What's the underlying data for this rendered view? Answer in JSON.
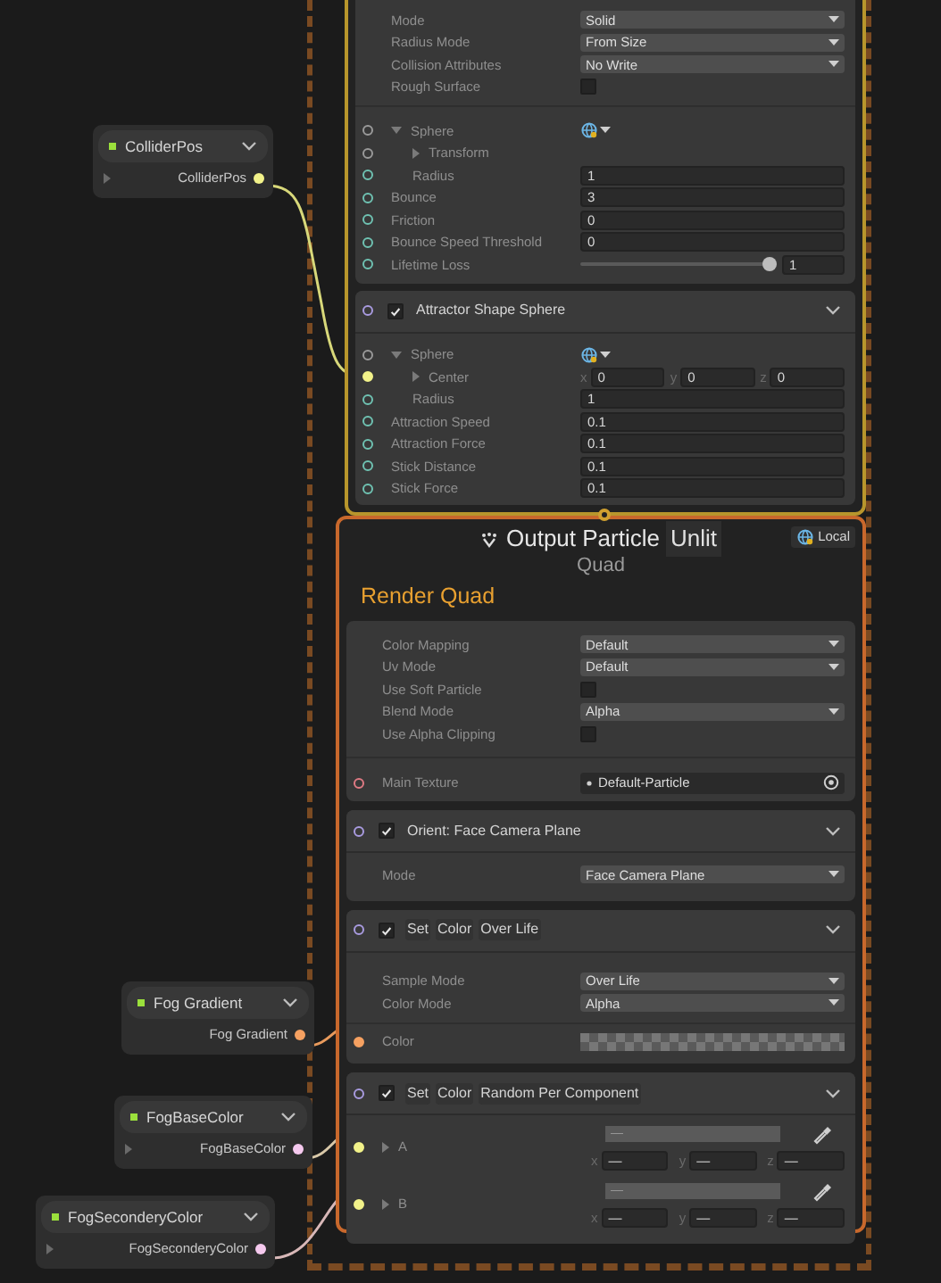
{
  "parameter_nodes": [
    {
      "title": "ColliderPos",
      "port_label": "ColliderPos",
      "expandable": true,
      "color": "#f2f28a"
    },
    {
      "title": "Fog Gradient",
      "port_label": "Fog Gradient",
      "expandable": false,
      "color": "#f6a161"
    },
    {
      "title": "FogBaseColor",
      "port_label": "FogBaseColor",
      "expandable": true,
      "color": "#f5c9ee"
    },
    {
      "title": "FogSeconderyColor",
      "port_label": "FogSeconderyColor",
      "expandable": true,
      "color": "#f5c9ee"
    }
  ],
  "collision_context": {
    "blocks": [
      {
        "sections": [
          [
            {
              "kind": "dropdown",
              "label": "Mode",
              "value": "Solid"
            },
            {
              "kind": "dropdown",
              "label": "Radius Mode",
              "value": "From Size"
            },
            {
              "kind": "dropdown",
              "label": "Collision Attributes",
              "value": "No Write"
            },
            {
              "kind": "checkbox",
              "label": "Rough Surface",
              "checked": false
            }
          ],
          [
            {
              "kind": "group",
              "label": "Sphere",
              "expanded": true,
              "port": {
                "color": "#9a9a9a",
                "connected": false
              },
              "children": [
                {
                  "kind": "foldout",
                  "label": "Transform",
                  "expanded": false,
                  "port": {
                    "color": "#9a9a9a",
                    "connected": false
                  }
                },
                {
                  "kind": "field",
                  "label": "Radius",
                  "value": "1",
                  "port": {
                    "color": "#6fc2b2",
                    "connected": false
                  }
                }
              ]
            },
            {
              "kind": "field",
              "label": "Bounce",
              "value": "3",
              "port": {
                "color": "#6fc2b2",
                "connected": false
              }
            },
            {
              "kind": "field",
              "label": "Friction",
              "value": "0",
              "port": {
                "color": "#6fc2b2",
                "connected": false
              }
            },
            {
              "kind": "field",
              "label": "Bounce Speed Threshold",
              "value": "0",
              "port": {
                "color": "#6fc2b2",
                "connected": false
              }
            },
            {
              "kind": "slider",
              "label": "Lifetime Loss",
              "level": 0.96,
              "value": "1",
              "port": {
                "color": "#6fc2b2",
                "connected": false
              }
            }
          ]
        ]
      },
      {
        "header": {
          "checked": true,
          "title_parts": [
            "Attractor Shape Sphere"
          ],
          "port": {
            "color": "#a99be0",
            "connected": false
          }
        },
        "sections": [
          [
            {
              "kind": "group",
              "label": "Sphere",
              "expanded": true,
              "port": {
                "color": "#9a9a9a",
                "connected": false
              },
              "children": [
                {
                  "kind": "vector",
                  "label": "Center",
                  "expanded": false,
                  "port": {
                    "color": "#f2f28a",
                    "connected": true
                  },
                  "components": [
                    {
                      "axis": "x",
                      "value": "0"
                    },
                    {
                      "axis": "y",
                      "value": "0"
                    },
                    {
                      "axis": "z",
                      "value": "0"
                    }
                  ]
                },
                {
                  "kind": "field",
                  "label": "Radius",
                  "value": "1",
                  "port": {
                    "color": "#6fc2b2",
                    "connected": false
                  }
                }
              ]
            },
            {
              "kind": "field",
              "label": "Attraction Speed",
              "value": "0.1",
              "port": {
                "color": "#6fc2b2",
                "connected": false
              }
            },
            {
              "kind": "field",
              "label": "Attraction Force",
              "value": "0.1",
              "port": {
                "color": "#6fc2b2",
                "connected": false
              }
            },
            {
              "kind": "field",
              "label": "Stick Distance",
              "value": "0.1",
              "port": {
                "color": "#6fc2b2",
                "connected": false
              }
            },
            {
              "kind": "field",
              "label": "Stick Force",
              "value": "0.1",
              "port": {
                "color": "#6fc2b2",
                "connected": false
              }
            }
          ]
        ]
      }
    ]
  },
  "output_context": {
    "title": "Output Particle",
    "title_tag": "Unlit",
    "space": "Local",
    "subtitle": "Quad",
    "label": "Render Quad",
    "blocks": [
      {
        "sections": [
          [
            {
              "kind": "dropdown",
              "label": "Color Mapping",
              "value": "Default"
            },
            {
              "kind": "dropdown",
              "label": "Uv Mode",
              "value": "Default"
            },
            {
              "kind": "checkbox",
              "label": "Use Soft Particle",
              "checked": false
            },
            {
              "kind": "dropdown",
              "label": "Blend Mode",
              "value": "Alpha"
            },
            {
              "kind": "checkbox",
              "label": "Use Alpha Clipping",
              "checked": false
            }
          ],
          [
            {
              "kind": "texture",
              "label": "Main Texture",
              "value": "Default-Particle",
              "port": {
                "color": "#e07a84",
                "connected": false
              }
            }
          ]
        ]
      },
      {
        "header": {
          "checked": true,
          "title_parts": [
            "Orient: Face Camera Plane"
          ],
          "port": {
            "color": "#a99be0",
            "connected": false
          }
        },
        "sections": [
          [
            {
              "kind": "dropdown",
              "label": "Mode",
              "value": "Face Camera Plane"
            }
          ]
        ]
      },
      {
        "header": {
          "checked": true,
          "title_parts": [
            "Set",
            "Color",
            "Over Life"
          ],
          "port": {
            "color": "#a99be0",
            "connected": false
          }
        },
        "sections": [
          [
            {
              "kind": "dropdown",
              "label": "Sample Mode",
              "value": "Over Life"
            },
            {
              "kind": "dropdown",
              "label": "Color Mode",
              "value": "Alpha"
            }
          ],
          [
            {
              "kind": "gradient",
              "label": "Color",
              "port": {
                "color": "#f6a161",
                "connected": true
              }
            }
          ]
        ]
      },
      {
        "header": {
          "checked": true,
          "title_parts": [
            "Set",
            "Color",
            "Random Per Component"
          ],
          "port": {
            "color": "#a99be0",
            "connected": false
          }
        },
        "sections": [
          [
            {
              "kind": "color_vector",
              "label": "A",
              "expanded": false,
              "value": "—",
              "port": {
                "color": "#f2f28a",
                "connected": true
              },
              "components": [
                {
                  "axis": "x",
                  "value": "—"
                },
                {
                  "axis": "y",
                  "value": "—"
                },
                {
                  "axis": "z",
                  "value": "—"
                }
              ]
            },
            {
              "kind": "color_vector",
              "label": "B",
              "expanded": false,
              "value": "—",
              "port": {
                "color": "#f2f28a",
                "connected": true
              },
              "components": [
                {
                  "axis": "x",
                  "value": "—"
                },
                {
                  "axis": "y",
                  "value": "—"
                },
                {
                  "axis": "z",
                  "value": "—"
                }
              ]
            }
          ]
        ]
      }
    ]
  }
}
